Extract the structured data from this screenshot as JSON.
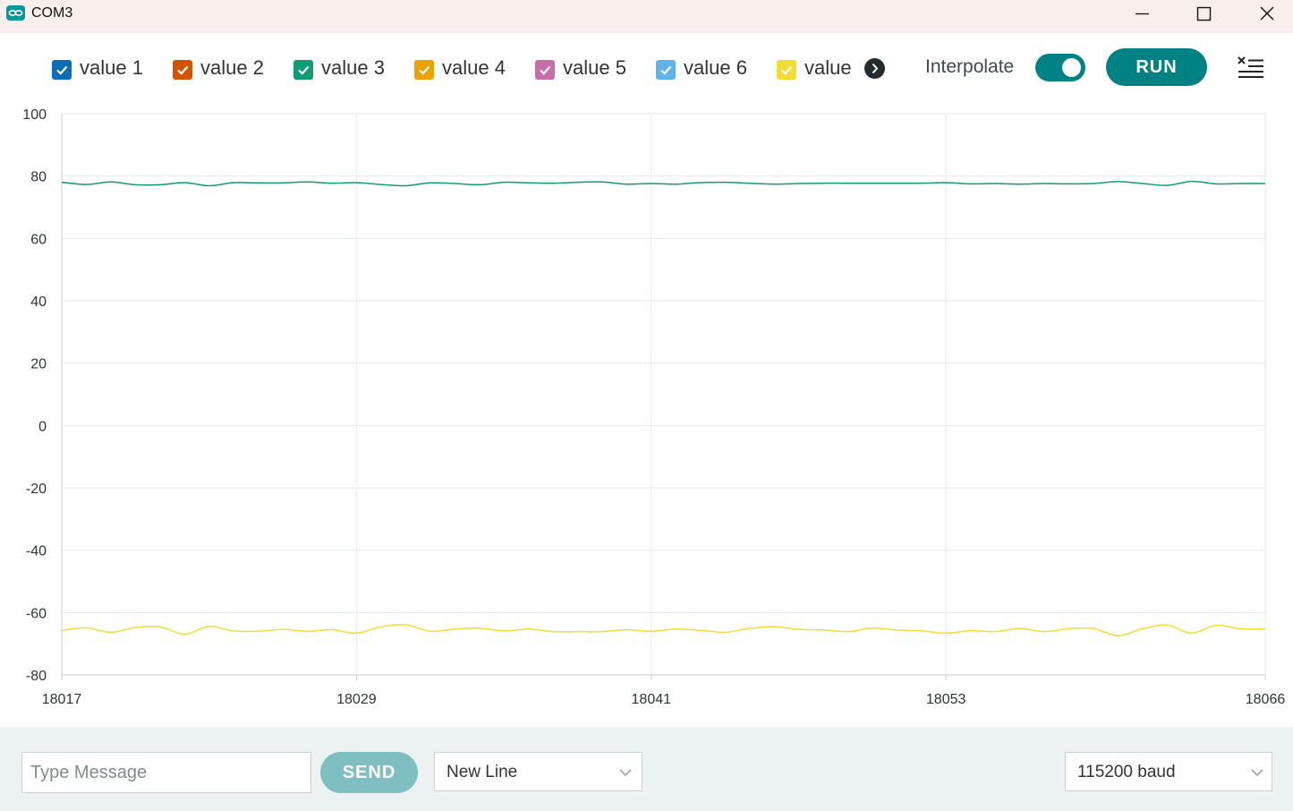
{
  "window": {
    "title": "COM3",
    "controls": [
      "minimize",
      "maximize",
      "close"
    ]
  },
  "legend": {
    "items": [
      {
        "label": "value 1",
        "color": "#0b6db5",
        "checked": true
      },
      {
        "label": "value 2",
        "color": "#d35400",
        "checked": true
      },
      {
        "label": "value 3",
        "color": "#109c74",
        "checked": true
      },
      {
        "label": "value 4",
        "color": "#eba100",
        "checked": true
      },
      {
        "label": "value 5",
        "color": "#c56ea8",
        "checked": true
      },
      {
        "label": "value 6",
        "color": "#5eb3e8",
        "checked": true
      },
      {
        "label": "value",
        "color": "#f1dd36",
        "checked": true
      }
    ],
    "next_icon": "chevron-right-icon"
  },
  "controls": {
    "interpolate_label": "Interpolate",
    "interpolate_on": true,
    "run_label": "RUN",
    "clear_icon": "clear-list-icon"
  },
  "chart_data": {
    "type": "line",
    "x": [
      18017,
      18018,
      18019,
      18020,
      18021,
      18022,
      18023,
      18024,
      18025,
      18026,
      18027,
      18028,
      18029,
      18030,
      18031,
      18032,
      18033,
      18034,
      18035,
      18036,
      18037,
      18038,
      18039,
      18040,
      18041,
      18042,
      18043,
      18044,
      18045,
      18046,
      18047,
      18048,
      18049,
      18050,
      18051,
      18052,
      18053,
      18054,
      18055,
      18056,
      18057,
      18058,
      18059,
      18060,
      18061,
      18062,
      18063,
      18064,
      18065,
      18066
    ],
    "series": [
      {
        "color": "#109c74",
        "values": [
          78.0,
          77.3,
          78.1,
          77.2,
          77.2,
          77.9,
          76.9,
          77.9,
          77.8,
          77.8,
          78.1,
          77.7,
          77.9,
          77.3,
          76.9,
          77.8,
          77.6,
          77.2,
          78.0,
          77.8,
          77.7,
          78.0,
          78.1,
          77.4,
          77.6,
          77.4,
          77.9,
          78.0,
          77.7,
          77.4,
          77.6,
          77.7,
          77.7,
          77.7,
          77.7,
          77.7,
          77.9,
          77.5,
          77.6,
          77.4,
          77.6,
          77.5,
          77.6,
          78.2,
          77.6,
          77.0,
          78.3,
          77.5,
          77.6,
          77.6
        ]
      },
      {
        "color": "#f1dd36",
        "values": [
          -65.7,
          -64.9,
          -66.3,
          -64.8,
          -64.6,
          -66.9,
          -64.4,
          -65.9,
          -66.0,
          -65.4,
          -66.0,
          -65.5,
          -66.6,
          -64.6,
          -63.9,
          -66.0,
          -65.3,
          -65.0,
          -65.9,
          -65.3,
          -66.1,
          -66.1,
          -66.1,
          -65.5,
          -66.0,
          -65.3,
          -65.7,
          -66.3,
          -65.1,
          -64.5,
          -65.4,
          -65.6,
          -66.1,
          -65.0,
          -65.6,
          -65.9,
          -66.6,
          -65.8,
          -66.1,
          -65.1,
          -66.1,
          -65.2,
          -65.1,
          -67.4,
          -65.2,
          -64.0,
          -66.6,
          -64.1,
          -65.2,
          -65.3
        ]
      }
    ],
    "xticks": [
      18017,
      18029,
      18041,
      18053,
      18066
    ],
    "yticks": [
      100,
      80,
      60,
      40,
      20,
      0,
      -20,
      -40,
      -60,
      -80
    ],
    "xlim": [
      18017,
      18066
    ],
    "ylim": [
      -80,
      100
    ],
    "grid": true,
    "title": "",
    "xlabel": "",
    "ylabel": ""
  },
  "footer": {
    "message_placeholder": "Type Message",
    "message_value": "",
    "send_label": "SEND",
    "line_ending": "New Line",
    "baud": "115200 baud"
  }
}
